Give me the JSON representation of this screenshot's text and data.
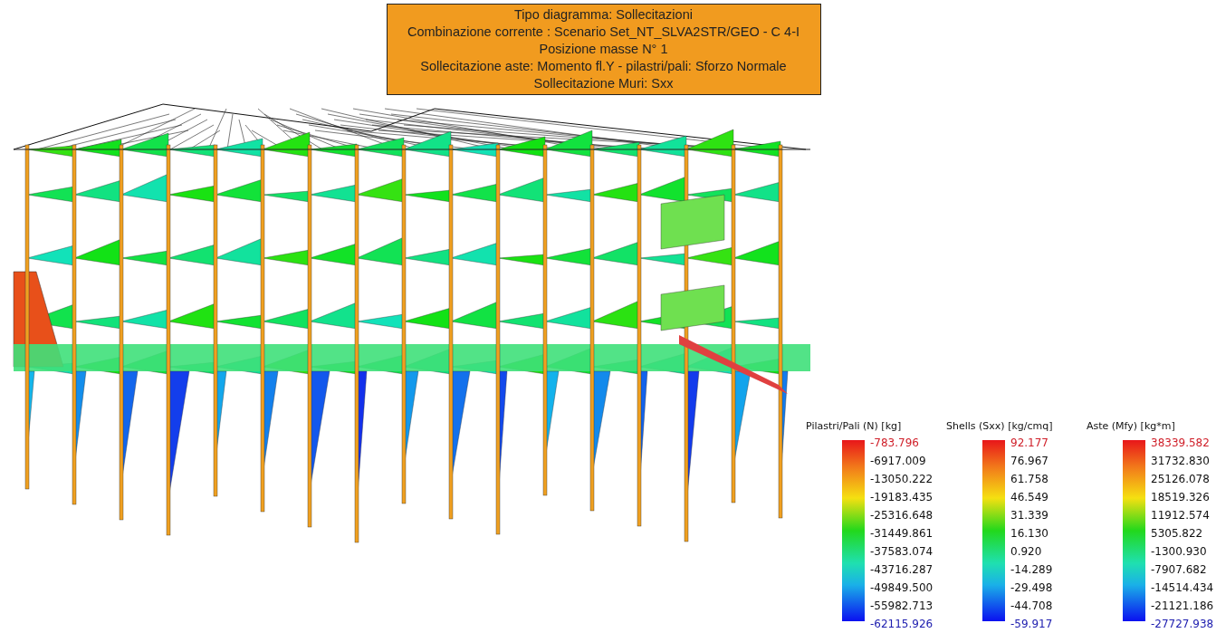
{
  "info_box": {
    "lines": [
      "Tipo diagramma: Sollecitazioni",
      "Combinazione corrente : Scenario Set_NT_SLVA2STR/GEO - C 4-I",
      "Posizione masse N° 1",
      "Sollecitazione aste: Momento fl.Y - pilastri/pali: Sforzo Normale",
      "Sollecitazione Muri: Sxx"
    ]
  },
  "legends": [
    {
      "title": "Pilastri/Pali (N) [kg]",
      "values": [
        {
          "text": "-783.796",
          "kind": "max"
        },
        {
          "text": "-6917.009",
          "kind": "mid"
        },
        {
          "text": "-13050.222",
          "kind": "mid"
        },
        {
          "text": "-19183.435",
          "kind": "mid"
        },
        {
          "text": "-25316.648",
          "kind": "mid"
        },
        {
          "text": "-31449.861",
          "kind": "mid"
        },
        {
          "text": "-37583.074",
          "kind": "mid"
        },
        {
          "text": "-43716.287",
          "kind": "mid"
        },
        {
          "text": "-49849.500",
          "kind": "mid"
        },
        {
          "text": "-55982.713",
          "kind": "mid"
        },
        {
          "text": "-62115.926",
          "kind": "min"
        }
      ]
    },
    {
      "title": "Shells (Sxx) [kg/cmq]",
      "values": [
        {
          "text": "92.177",
          "kind": "max"
        },
        {
          "text": "76.967",
          "kind": "mid"
        },
        {
          "text": "61.758",
          "kind": "mid"
        },
        {
          "text": "46.549",
          "kind": "mid"
        },
        {
          "text": "31.339",
          "kind": "mid"
        },
        {
          "text": "16.130",
          "kind": "mid"
        },
        {
          "text": "0.920",
          "kind": "mid"
        },
        {
          "text": "-14.289",
          "kind": "mid"
        },
        {
          "text": "-29.498",
          "kind": "mid"
        },
        {
          "text": "-44.708",
          "kind": "mid"
        },
        {
          "text": "-59.917",
          "kind": "min"
        }
      ]
    },
    {
      "title": "Aste (Mfy) [kg*m]",
      "values": [
        {
          "text": "38339.582",
          "kind": "max"
        },
        {
          "text": "31732.830",
          "kind": "mid"
        },
        {
          "text": "25126.078",
          "kind": "mid"
        },
        {
          "text": "18519.326",
          "kind": "mid"
        },
        {
          "text": "11912.574",
          "kind": "mid"
        },
        {
          "text": "5305.822",
          "kind": "mid"
        },
        {
          "text": "-1300.930",
          "kind": "mid"
        },
        {
          "text": "-7907.682",
          "kind": "mid"
        },
        {
          "text": "-14514.434",
          "kind": "mid"
        },
        {
          "text": "-21121.186",
          "kind": "mid"
        },
        {
          "text": "-27727.938",
          "kind": "min"
        }
      ]
    }
  ]
}
